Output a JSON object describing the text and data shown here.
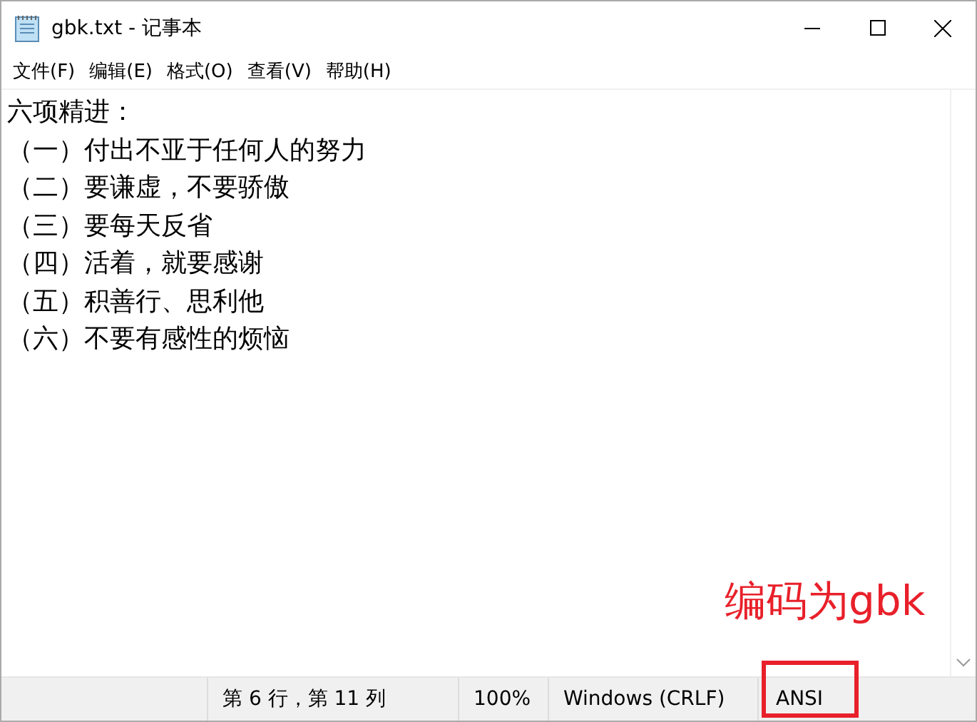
{
  "window": {
    "title": "gbk.txt - 记事本"
  },
  "menu": [
    "文件(F)",
    "编辑(E)",
    "格式(O)",
    "查看(V)",
    "帮助(H)"
  ],
  "editor": {
    "lines": [
      "六项精进：",
      "（一）付出不亚于任何人的努力",
      "（二）要谦虚，不要骄傲",
      "（三）要每天反省",
      "（四）活着，就要感谢",
      "（五）积善行、思利他",
      "（六）不要有感性的烦恼"
    ]
  },
  "status_bar": {
    "position": "第 6 行，第 11 列",
    "zoom": "100%",
    "line_ending": "Windows (CRLF)",
    "encoding": "ANSI"
  },
  "annotation": {
    "text": "编码为gbk"
  }
}
